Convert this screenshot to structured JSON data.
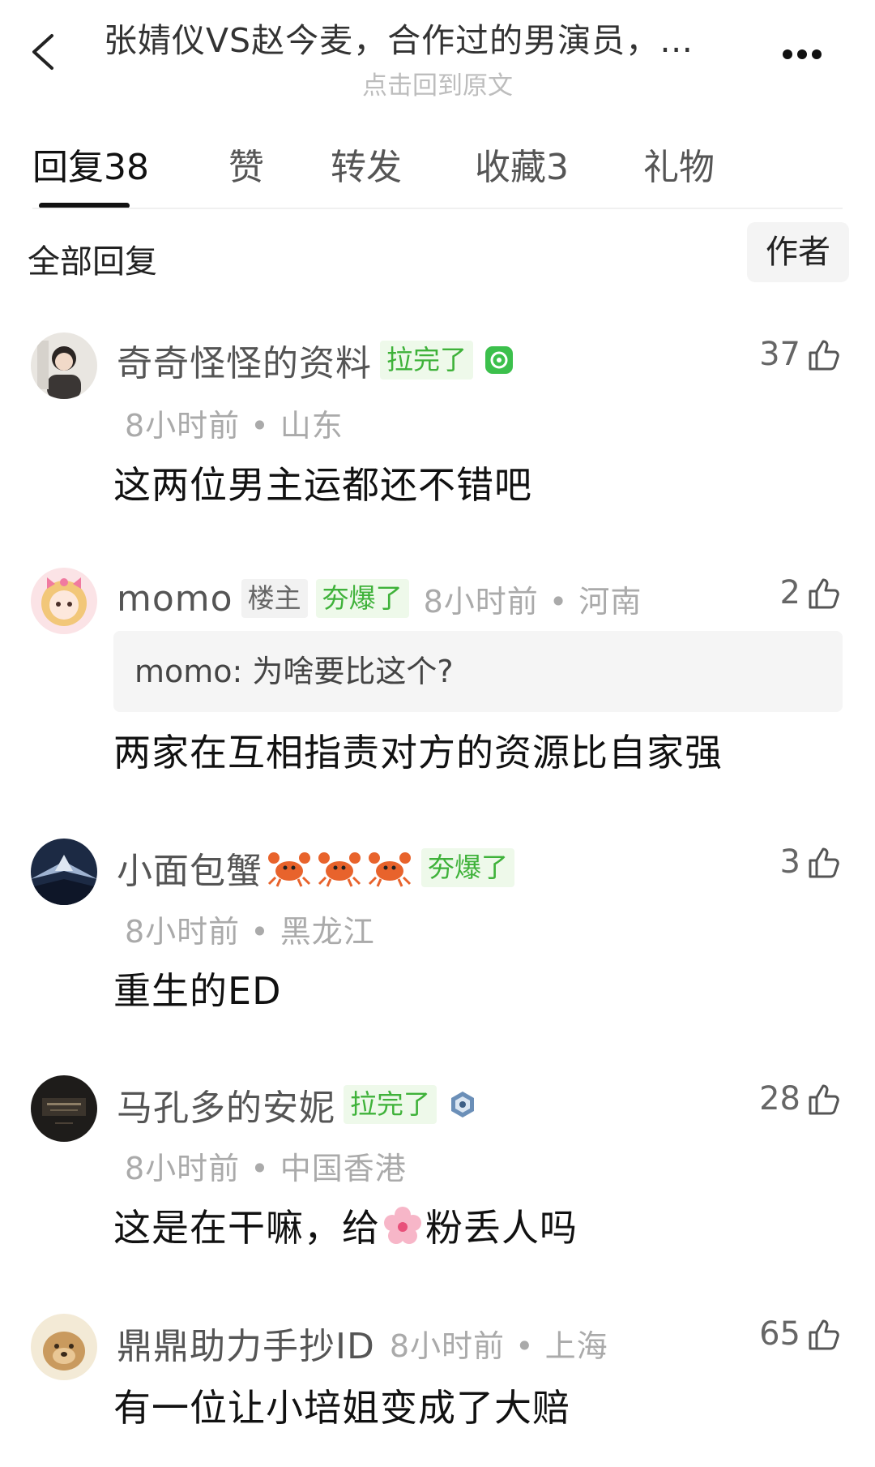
{
  "header": {
    "title": "张婧仪VS赵今麦，合作过的男演员，…",
    "subtitle": "点击回到原文"
  },
  "tabs": [
    {
      "label": "回复38",
      "active": true
    },
    {
      "label": "赞",
      "active": false
    },
    {
      "label": "转发",
      "active": false
    },
    {
      "label": "收藏3",
      "active": false
    },
    {
      "label": "礼物",
      "active": false
    }
  ],
  "filter": {
    "label": "全部回复",
    "author_button": "作者"
  },
  "comments": [
    {
      "username": "奇奇怪怪的资料",
      "tag": "拉完了",
      "time": "8小时前",
      "location": "山东",
      "likes": "37",
      "text": "这两位男主运都还不错吧"
    },
    {
      "username": "momo",
      "role": "楼主",
      "tag": "夯爆了",
      "time": "8小时前",
      "location": "河南",
      "likes": "2",
      "quote": "momo: 为啥要比这个?",
      "text": "两家在互相指责对方的资源比自家强"
    },
    {
      "username": "小面包蟹",
      "tag": "夯爆了",
      "time": "8小时前",
      "location": "黑龙江",
      "likes": "3",
      "text": "重生的ED"
    },
    {
      "username": "马孔多的安妮",
      "tag": "拉完了",
      "time": "8小时前",
      "location": "中国香港",
      "likes": "28",
      "text_before": "这是在干嘛，给",
      "text_after": "粉丢人吗"
    },
    {
      "username": "鼎鼎助力手抄ID",
      "time": "8小时前",
      "location": "上海",
      "likes": "65",
      "text": "有一位让小培姐变成了大赔"
    }
  ],
  "separator": " • ",
  "colors": {
    "tag_bg": "#eef9ea",
    "tag_text": "#3fb23a",
    "username": "#555555",
    "meta": "#aaaaaa"
  }
}
